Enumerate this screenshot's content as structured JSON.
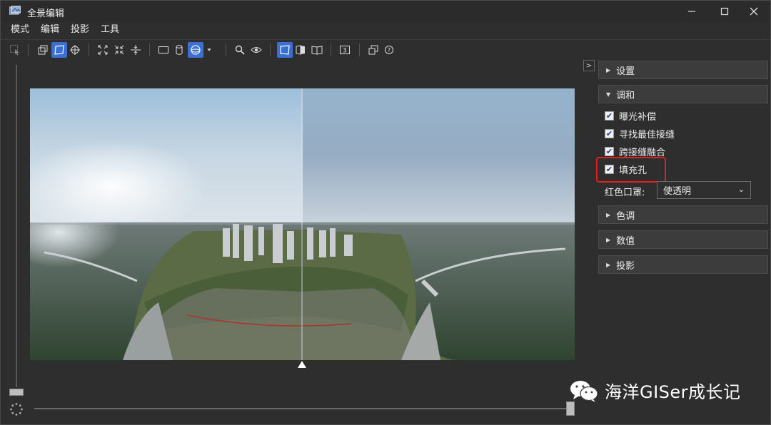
{
  "window": {
    "title": "全景编辑"
  },
  "menu": {
    "items": [
      "模式",
      "编辑",
      "投影",
      "工具"
    ]
  },
  "panel": {
    "sections": [
      {
        "label": "设置",
        "expanded": false
      },
      {
        "label": "调和",
        "expanded": true
      },
      {
        "label": "色调",
        "expanded": false
      },
      {
        "label": "数值",
        "expanded": false
      },
      {
        "label": "投影",
        "expanded": false
      }
    ],
    "blend_options": [
      {
        "label": "曝光补偿",
        "checked": true
      },
      {
        "label": "寻找最佳接缝",
        "checked": true
      },
      {
        "label": "跨接缝融合",
        "checked": true
      },
      {
        "label": "填充孔",
        "checked": true
      }
    ],
    "mask": {
      "label": "红色口罩:",
      "value": "使透明"
    }
  },
  "watermark": {
    "text": "海洋GISer成长记"
  },
  "colors": {
    "accent": "#3b6fd4",
    "highlight": "#e0201c"
  }
}
